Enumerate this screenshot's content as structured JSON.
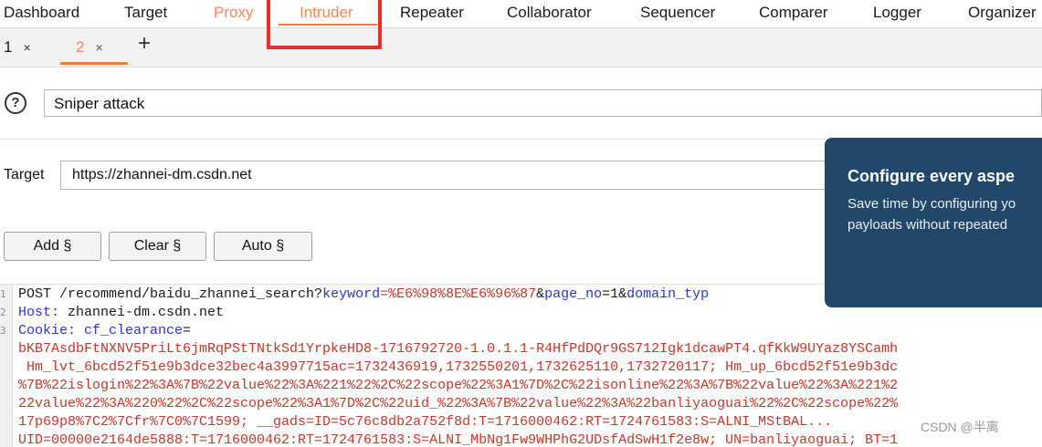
{
  "nav": {
    "tabs": [
      {
        "label": "Dashboard"
      },
      {
        "label": "Target"
      },
      {
        "label": "Proxy"
      },
      {
        "label": "Intruder"
      },
      {
        "label": "Repeater"
      },
      {
        "label": "Collaborator"
      },
      {
        "label": "Sequencer"
      },
      {
        "label": "Comparer"
      },
      {
        "label": "Logger"
      },
      {
        "label": "Organizer"
      }
    ],
    "active": "Intruder"
  },
  "subtabs": [
    {
      "label": "1",
      "close": "×"
    },
    {
      "label": "2",
      "close": "×"
    }
  ],
  "add_tab_label": "+",
  "attack": {
    "help_label": "?",
    "type": "Sniper attack"
  },
  "target": {
    "label": "Target",
    "value": "https://zhannei-dm.csdn.net"
  },
  "buttons": {
    "add": "Add §",
    "clear": "Clear §",
    "auto": "Auto §"
  },
  "popover": {
    "title": "Configure every aspe",
    "body_line1": "Save time by configuring yo",
    "body_line2": "payloads without repeated"
  },
  "editor": {
    "line_numbers": [
      "1",
      "2",
      "3"
    ],
    "request_line": {
      "method_path": "POST /recommend/baidu_zhannei_search?",
      "p1k": "keyword",
      "p1v": "=%E6%98%8E%E6%96%87",
      "amp1": "&",
      "p2k": "page_no",
      "p2v": "=1",
      "amp2": "&",
      "p3k": "domain_typ"
    },
    "host": {
      "name": "Host:",
      "value": " zhannei-dm.csdn.net"
    },
    "cookie_header": {
      "name": "Cookie:",
      "k": " cf_clearance",
      "eq": "="
    },
    "raw": [
      "bKB7AsdbFtNXNV5PriLt6jmRqPStTNtkSd1YrpkeHD8-1716792720-1.0.1.1-R4HfPdDQr9GS712Igk1dcawPT4.qfKkW9UYaz8YSCamh",
      " Hm_lvt_6bcd52f51e9b3dce32bec4a3997715ac=1732436919,1732550201,1732625110,1732720117; Hm_up_6bcd52f51e9b3dc",
      "%7B%22islogin%22%3A%7B%22value%22%3A%221%22%2C%22scope%22%3A1%7D%2C%22isonline%22%3A%7B%22value%22%3A%221%2",
      "22value%22%3A%220%22%2C%22scope%22%3A1%7D%2C%22uid_%22%3A%7B%22value%22%3A%22banliyaoguai%22%2C%22scope%22%",
      "17p69p8%7C2%7Cfr%7C0%7C1599; __gads=ID=5c76c8db2a752f8d:T=1716000462:RT=1724761583:S=ALNI_MStBAL...",
      "UID=00000e2164de5888:T=1716000462:RT=1724761583:S=ALNI_MbNg1Fw9WHPhG2UDsfAdSwH1f2e8w; UN=banliyaoguai; BT=1"
    ]
  },
  "watermark": "CSDN @半离",
  "colors": {
    "accent": "#ee7b43",
    "highlight_box": "#ec2d2d",
    "popover_bg": "#21476b",
    "param_key": "#2a33d6",
    "param_value": "#c0392b"
  }
}
